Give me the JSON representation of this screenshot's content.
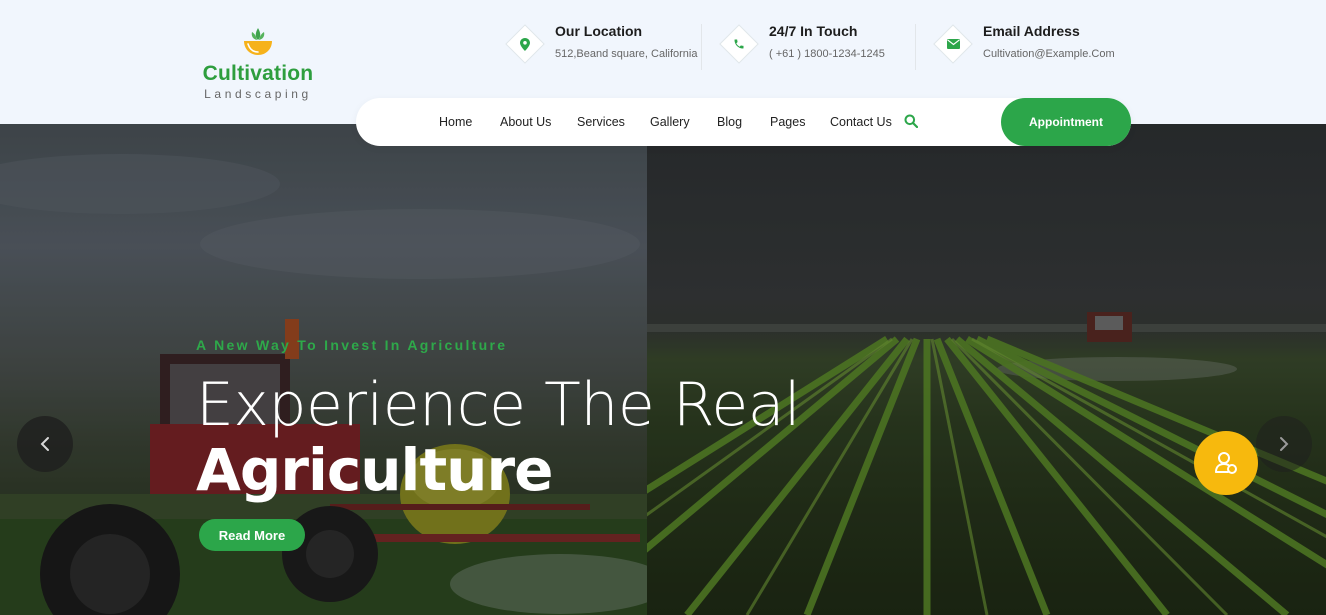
{
  "brand": {
    "name": "Cultivation",
    "tagline": "Landscaping"
  },
  "contacts": [
    {
      "title": "Our Location",
      "detail": "512,Beand square, California",
      "icon": "map-pin-icon"
    },
    {
      "title": "24/7 In Touch",
      "detail": "( +61 ) 1800-1234-1245",
      "icon": "phone-icon"
    },
    {
      "title": "Email Address",
      "detail": "Cultivation@Example.Com",
      "icon": "envelope-icon"
    }
  ],
  "nav": {
    "items": [
      "Home",
      "About Us",
      "Services",
      "Gallery",
      "Blog",
      "Pages",
      "Contact Us"
    ],
    "search_icon": "search-icon",
    "cta": "Appointment"
  },
  "hero": {
    "kicker": "A New Way To Invest In Agriculture",
    "headline_light": "Experience The Real",
    "headline_bold": "Agriculture",
    "button": "Read More",
    "prev_icon": "chevron-left-icon",
    "next_icon": "chevron-right-icon",
    "fab_icon": "users-icon"
  },
  "colors": {
    "primary_green": "#2ca64a",
    "accent_yellow": "#f7b90d",
    "header_bg": "#f1f6fd"
  }
}
